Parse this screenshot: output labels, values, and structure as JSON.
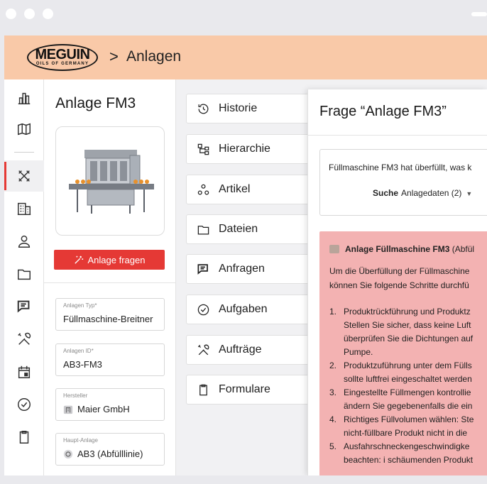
{
  "header": {
    "logo_brand": "MEGUIN",
    "logo_tagline": "OILS OF GERMANY",
    "breadcrumb_sep": ">",
    "breadcrumb": "Anlagen"
  },
  "details": {
    "title": "Anlage FM3",
    "ask_button": "Anlage fragen",
    "fields": [
      {
        "label": "Anlagen Typ*",
        "value": "Füllmaschine-Breitner"
      },
      {
        "label": "Anlagen ID*",
        "value": "AB3-FM3"
      },
      {
        "label": "Hersteller",
        "value": "Maier GmbH"
      },
      {
        "label": "Haupt-Anlage",
        "value": "AB3 (Abfülllinie)"
      }
    ]
  },
  "tabs": [
    {
      "label": "Historie",
      "icon": "history-icon"
    },
    {
      "label": "Hierarchie",
      "icon": "hierarchy-icon"
    },
    {
      "label": "Artikel",
      "icon": "article-icon"
    },
    {
      "label": "Dateien",
      "icon": "folder-icon"
    },
    {
      "label": "Anfragen",
      "icon": "chat-icon"
    },
    {
      "label": "Aufgaben",
      "icon": "check-circle-icon"
    },
    {
      "label": "Aufträge",
      "icon": "tools-icon"
    },
    {
      "label": "Formulare",
      "icon": "clipboard-icon"
    }
  ],
  "question": {
    "title": "Frage “Anlage FM3”",
    "text": "Füllmaschine FM3 hat überfüllt, was k",
    "search_label": "Suche",
    "search_value": "Anlagedaten (2)",
    "answer_title_bold": "Anlage Füllmaschine FM3",
    "answer_title_rest": "(Abfül",
    "intro_1": "Um die Überfüllung der Füllmaschine",
    "intro_2": "können Sie folgende Schritte durchfü",
    "steps": [
      {
        "n": "1.",
        "lines": [
          "Produktrückführung und Produktz",
          "Stellen Sie sicher, dass keine Luft",
          "überprüfen Sie die Dichtungen auf",
          "Pumpe."
        ]
      },
      {
        "n": "2.",
        "lines": [
          "Produktzuführung unter dem Fülls",
          "sollte luftfrei eingeschaltet werden"
        ]
      },
      {
        "n": "3.",
        "lines": [
          "Eingestellte Füllmengen kontrollie",
          "ändern Sie gegebenenfalls die ein"
        ]
      },
      {
        "n": "4.",
        "lines": [
          "Richtiges Füllvolumen wählen: Ste",
          "nicht-füllbare Produkt nicht in die"
        ]
      },
      {
        "n": "5.",
        "lines": [
          "Ausfahrschneckengeschwindigke",
          "beachten: i schäumenden Produkt"
        ]
      }
    ]
  },
  "colors": {
    "header_bg": "#f9c9a8",
    "accent_red": "#e53935",
    "answer_bg": "#f3b2b2"
  }
}
